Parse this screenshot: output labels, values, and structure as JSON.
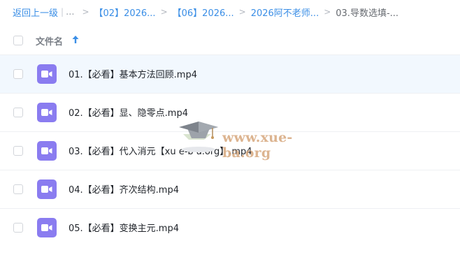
{
  "breadcrumb": {
    "back_label": "返回上一级",
    "bar": "|",
    "ellipsis": "...",
    "separator": ">",
    "items": [
      "【02】2026...",
      "【06】2026...",
      "2026阿不老师...",
      "03.导数选填-..."
    ]
  },
  "header": {
    "name_column": "文件名",
    "sort_direction": "ascending"
  },
  "files": [
    {
      "name": "01.【必看】基本方法回顾.mp4",
      "icon": "video-file-icon",
      "selected": true
    },
    {
      "name": "02.【必看】显、隐零点.mp4",
      "icon": "video-file-icon",
      "selected": false
    },
    {
      "name": "03.【必看】代入消元【xu e-b a.org】.mp4",
      "icon": "video-file-icon",
      "selected": false
    },
    {
      "name": "04.【必看】齐次结构.mp4",
      "icon": "video-file-icon",
      "selected": false
    },
    {
      "name": "05.【必看】变换主元.mp4",
      "icon": "video-file-icon",
      "selected": false
    }
  ],
  "watermark": {
    "text": "www.xue-ba.org"
  },
  "colors": {
    "link": "#3a8ee6",
    "video_icon": "#8a7cf0",
    "selected_row": "#f2f8fe",
    "watermark": "#d7a77d"
  }
}
